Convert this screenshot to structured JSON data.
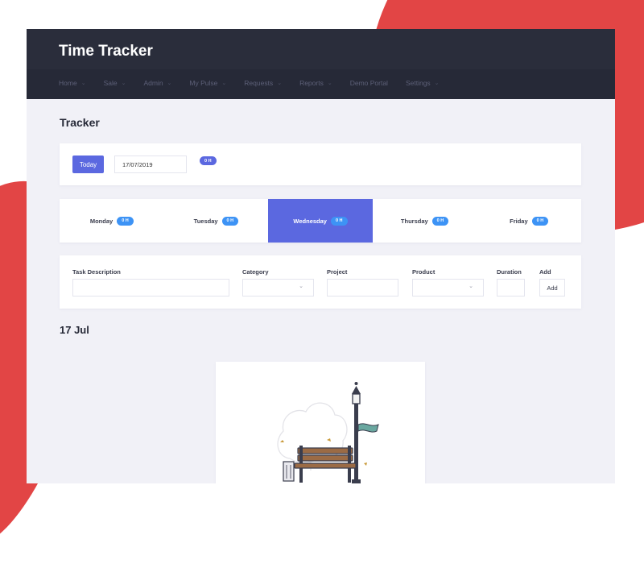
{
  "app": {
    "title": "Time Tracker"
  },
  "nav": [
    {
      "label": "Home"
    },
    {
      "label": "Sale"
    },
    {
      "label": "Admin"
    },
    {
      "label": "My Pulse"
    },
    {
      "label": "Requests"
    },
    {
      "label": "Reports"
    },
    {
      "label": "Demo Portal"
    },
    {
      "label": "Settings"
    }
  ],
  "page": {
    "title": "Tracker"
  },
  "date_bar": {
    "today_label": "Today",
    "date_value": "17/07/2019",
    "total_badge": "0 H"
  },
  "days": [
    {
      "label": "Monday",
      "hours": "0 H"
    },
    {
      "label": "Tuesday",
      "hours": "0 H"
    },
    {
      "label": "Wednesday",
      "hours": "0 H"
    },
    {
      "label": "Thursday",
      "hours": "0 H"
    },
    {
      "label": "Friday",
      "hours": "0 H"
    }
  ],
  "form": {
    "task_label": "Task Description",
    "category_label": "Category",
    "project_label": "Project",
    "product_label": "Product",
    "duration_label": "Duration",
    "add_label": "Add",
    "add_button": "Add"
  },
  "entries": {
    "date_heading": "17 Jul"
  },
  "colors": {
    "accent": "#5b68e0",
    "badge_blue": "#3d93f5",
    "header_dark": "#262937",
    "brand_red": "#e24545"
  }
}
